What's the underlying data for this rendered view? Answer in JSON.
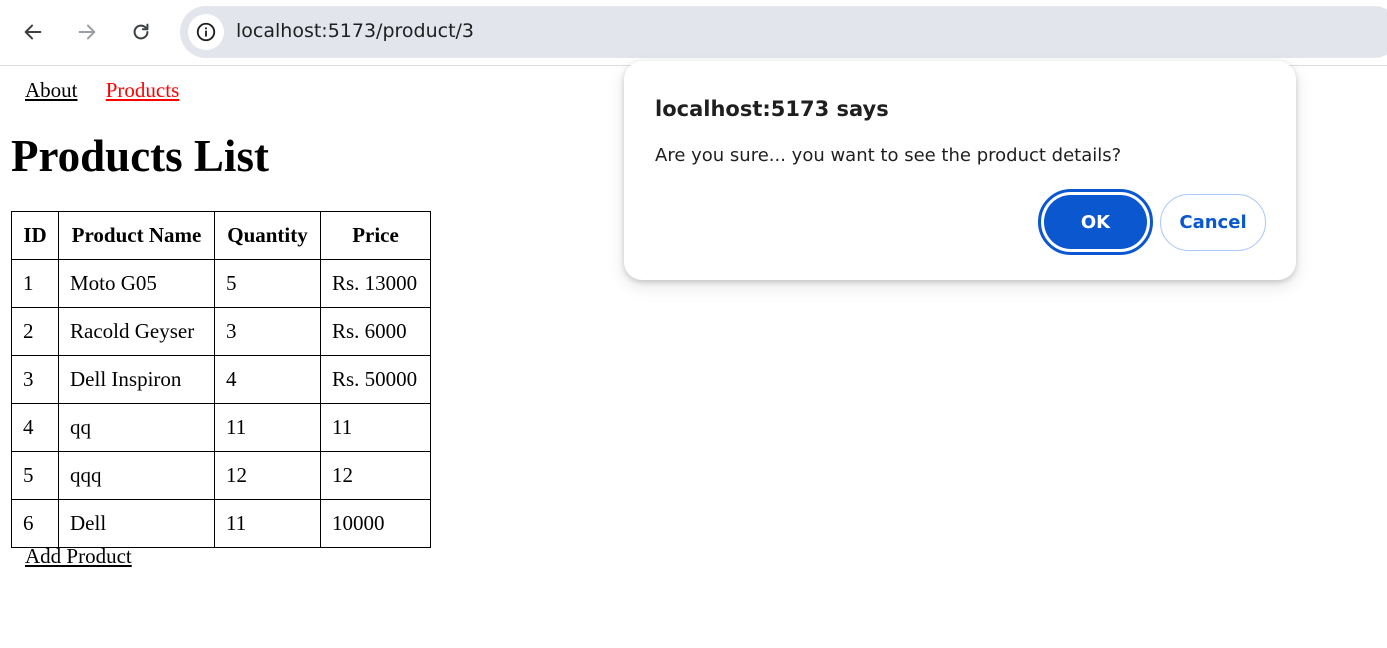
{
  "browser": {
    "url": "localhost:5173/product/3"
  },
  "nav": {
    "about": "About",
    "products": "Products"
  },
  "page": {
    "title": "Products List",
    "add_product": "Add Product"
  },
  "table": {
    "headers": [
      "ID",
      "Product Name",
      "Quantity",
      "Price"
    ],
    "rows": [
      [
        "1",
        "Moto G05",
        "5",
        "Rs. 13000"
      ],
      [
        "2",
        "Racold Geyser",
        "3",
        "Rs. 6000"
      ],
      [
        "3",
        "Dell Inspiron",
        "4",
        "Rs. 50000"
      ],
      [
        "4",
        "qq",
        "11",
        "11"
      ],
      [
        "5",
        "qqq",
        "12",
        "12"
      ],
      [
        "6",
        "Dell",
        "11",
        "10000"
      ]
    ]
  },
  "dialog": {
    "title": "localhost:5173 says",
    "message": "Are you sure... you want to see the product details?",
    "ok_label": "OK",
    "cancel_label": "Cancel"
  },
  "colors": {
    "accent": "#0b57d0",
    "active_link": "#ff0000",
    "omnibox": "#e2e6ec"
  }
}
